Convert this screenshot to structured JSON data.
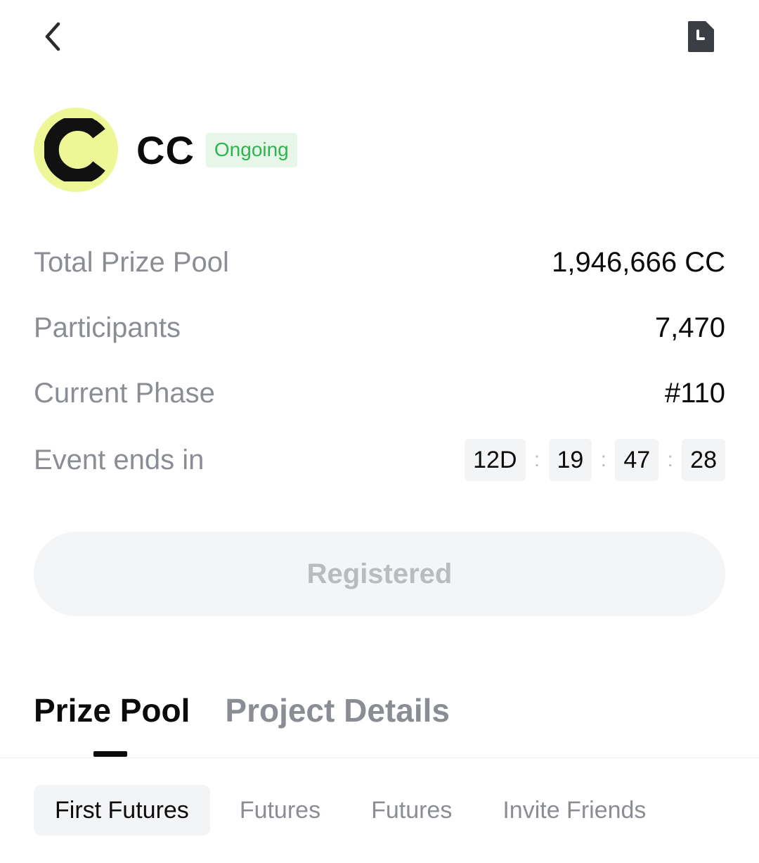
{
  "nav": {
    "back_icon": "chevron-left-icon",
    "history_icon": "document-clock-icon"
  },
  "project": {
    "logo_icon": "cc-logo",
    "name": "CC",
    "status": "Ongoing",
    "colors": {
      "logo_bg": "#eef796",
      "status_bg": "#e8f6ea",
      "status_text": "#2fb54e"
    }
  },
  "info": {
    "prize_pool_label": "Total Prize Pool",
    "prize_pool_value": "1,946,666 CC",
    "participants_label": "Participants",
    "participants_value": "7,470",
    "phase_label": "Current Phase",
    "phase_value": "#110",
    "ends_label": "Event ends in",
    "countdown": {
      "days": "12D",
      "hours": "19",
      "minutes": "47",
      "seconds": "28",
      "separator": ":"
    }
  },
  "action": {
    "registered_label": "Registered"
  },
  "tabs": {
    "main": [
      "Prize Pool",
      "Project Details"
    ],
    "sub": [
      "First Futures",
      "Futures",
      "Futures",
      "Invite Friends"
    ]
  }
}
